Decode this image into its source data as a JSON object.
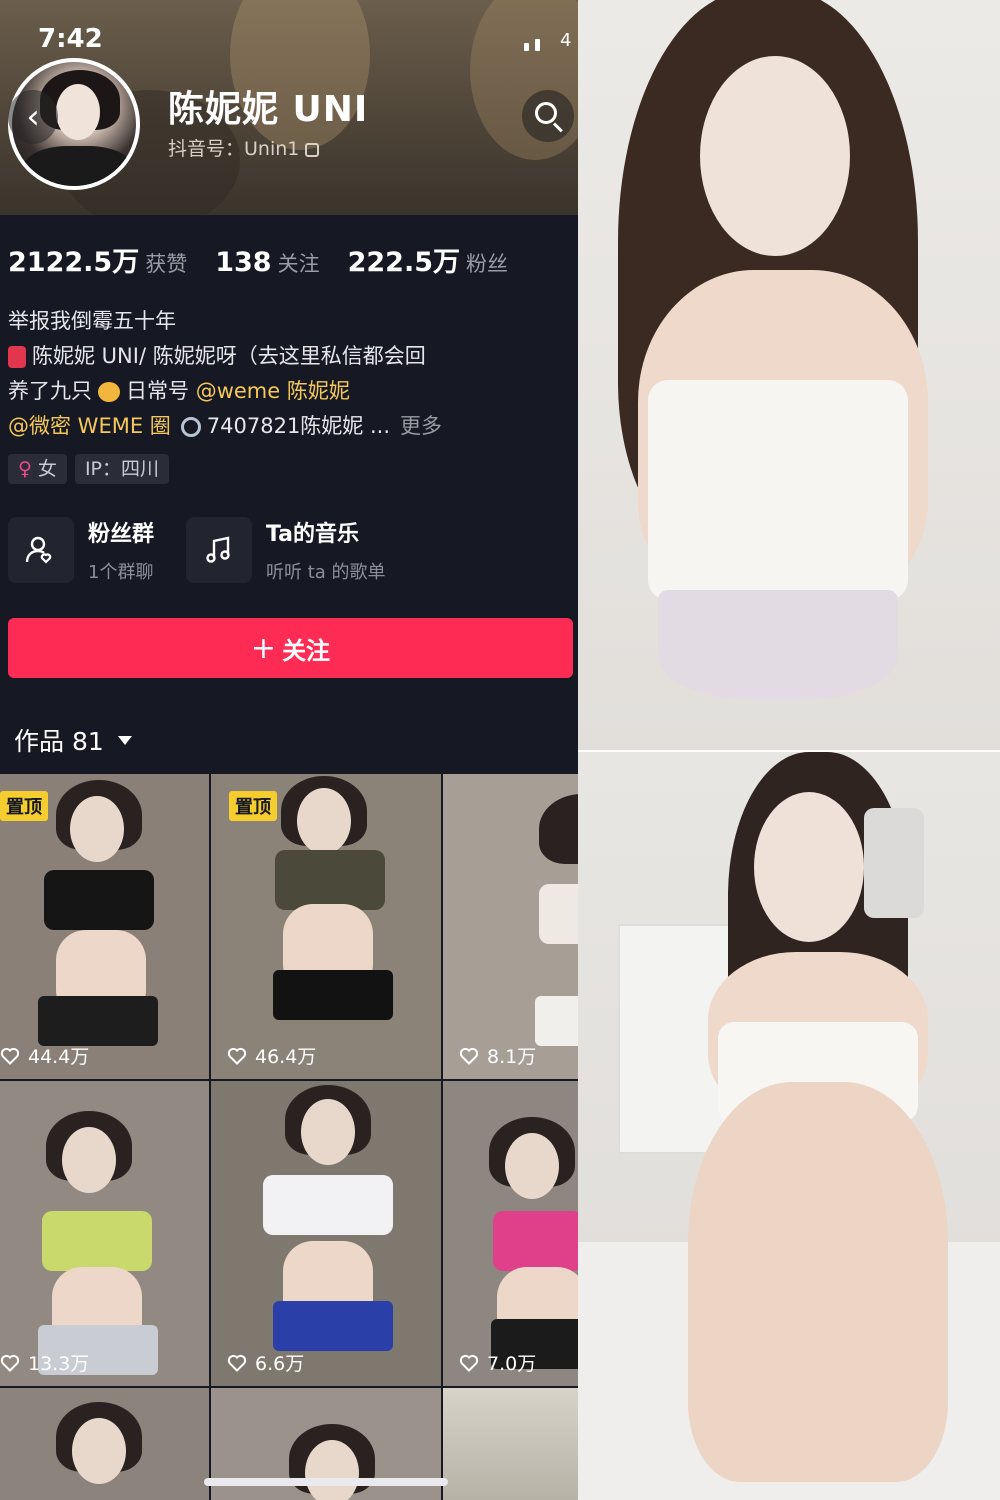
{
  "status": {
    "time": "7:42",
    "battery": "4"
  },
  "profile": {
    "name": "陈妮妮 UNI",
    "douyin_id": "抖音号：Unin1",
    "stats": [
      {
        "value": "2122.5万",
        "label": "获赞"
      },
      {
        "value": "138",
        "label": "关注"
      },
      {
        "value": "222.5万",
        "label": "粉丝"
      }
    ],
    "bio": {
      "line1": "举报我倒霉五十年",
      "line2": "陈妮妮 UNI/ 陈妮妮呀（去这里私信都会回",
      "line3_a": "养了九只",
      "line3_b": "日常号",
      "line3_link": "@weme 陈妮妮",
      "line4_link": "@微密 WEME 圈",
      "line4_text": "7407821陈妮妮 ...",
      "more": "更多"
    },
    "tags": [
      "女",
      "IP：四川"
    ]
  },
  "cards": [
    {
      "title": "粉丝群",
      "subtitle": "1个群聊",
      "icon": "group-icon"
    },
    {
      "title": "Ta的音乐",
      "subtitle": "听听 ta 的歌单",
      "icon": "music-note-icon"
    }
  ],
  "follow_button": {
    "label": "关注"
  },
  "works": {
    "label": "作品 81"
  },
  "videos": [
    {
      "pinned": "置顶",
      "likes": "44.4万"
    },
    {
      "pinned": "置顶",
      "likes": "46.4万"
    },
    {
      "likes": "8.1万"
    },
    {
      "likes": "13.3万"
    },
    {
      "likes": "6.6万"
    },
    {
      "likes": "7.0万"
    }
  ],
  "colors": {
    "accent": "#fe2c55",
    "pin": "#f6cd2e",
    "link": "#f4c85a",
    "background": "#161823"
  }
}
